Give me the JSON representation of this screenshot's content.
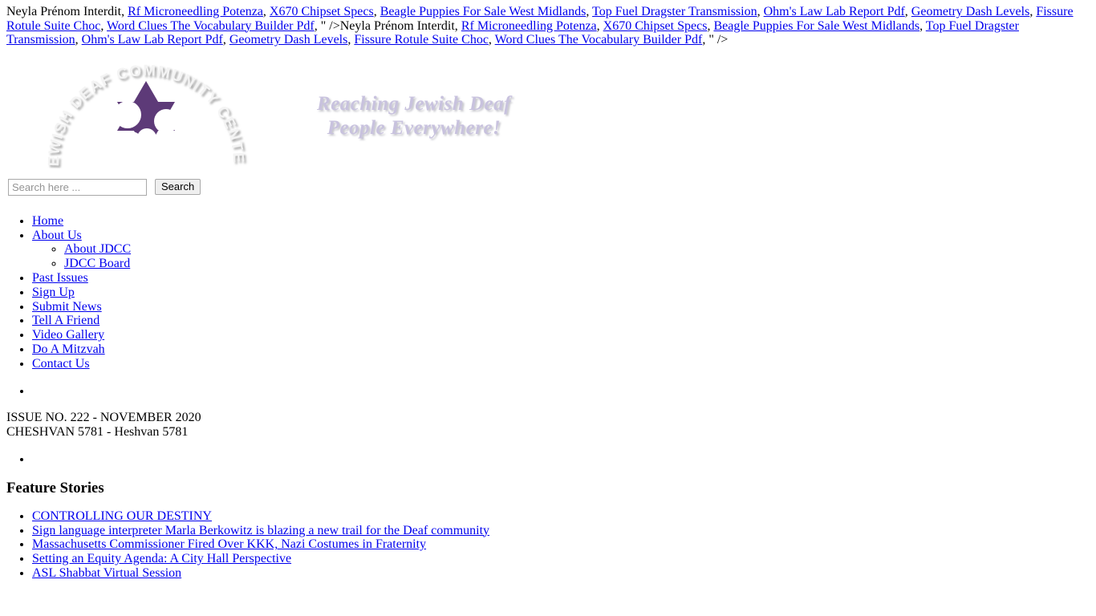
{
  "spam": {
    "segments": [
      {
        "type": "text",
        "text": "Neyla Prénom Interdit, "
      },
      {
        "type": "link",
        "text": "Rf Microneedling Potenza"
      },
      {
        "type": "text",
        "text": ", "
      },
      {
        "type": "link",
        "text": "X670 Chipset Specs"
      },
      {
        "type": "text",
        "text": ", "
      },
      {
        "type": "link",
        "text": "Beagle Puppies For Sale West Midlands"
      },
      {
        "type": "text",
        "text": ", "
      },
      {
        "type": "link",
        "text": "Top Fuel Dragster Transmission"
      },
      {
        "type": "text",
        "text": ", "
      },
      {
        "type": "link",
        "text": "Ohm's Law Lab Report Pdf"
      },
      {
        "type": "text",
        "text": ", "
      },
      {
        "type": "link",
        "text": "Geometry Dash Levels"
      },
      {
        "type": "text",
        "text": ", "
      },
      {
        "type": "link",
        "text": "Fissure Rotule Suite Choc"
      },
      {
        "type": "text",
        "text": ", "
      },
      {
        "type": "link",
        "text": "Word Clues The Vocabulary Builder Pdf"
      },
      {
        "type": "text",
        "text": ", \" />Neyla Prénom Interdit, "
      },
      {
        "type": "link",
        "text": "Rf Microneedling Potenza"
      },
      {
        "type": "text",
        "text": ", "
      },
      {
        "type": "link",
        "text": "X670 Chipset Specs"
      },
      {
        "type": "text",
        "text": ", "
      },
      {
        "type": "link",
        "text": "Beagle Puppies For Sale West Midlands"
      },
      {
        "type": "text",
        "text": ", "
      },
      {
        "type": "link",
        "text": "Top Fuel Dragster Transmission"
      },
      {
        "type": "text",
        "text": ", "
      },
      {
        "type": "link",
        "text": "Ohm's Law Lab Report Pdf"
      },
      {
        "type": "text",
        "text": ", "
      },
      {
        "type": "link",
        "text": "Geometry Dash Levels"
      },
      {
        "type": "text",
        "text": ", "
      },
      {
        "type": "link",
        "text": "Fissure Rotule Suite Choc"
      },
      {
        "type": "text",
        "text": ", "
      },
      {
        "type": "link",
        "text": "Word Clues The Vocabulary Builder Pdf"
      },
      {
        "type": "text",
        "text": ", \" />"
      }
    ]
  },
  "logo": {
    "arc_text": "JEWISH DEAF COMMUNITY CENTER",
    "alt": "Jewish Deaf Community Center logo",
    "purple": "#5d3a78",
    "arc_text_color": "#f2f2f2"
  },
  "tagline": {
    "line1": "Reaching Jewish Deaf",
    "line2": "People Everywhere!",
    "color": "#c8c2de"
  },
  "search": {
    "placeholder": "Search here ...",
    "value": "",
    "button_label": "Search"
  },
  "nav": {
    "items": [
      {
        "label": "Home",
        "children": []
      },
      {
        "label": "About Us",
        "children": [
          {
            "label": "About JDCC"
          },
          {
            "label": "JDCC Board"
          }
        ]
      },
      {
        "label": "Past Issues",
        "children": []
      },
      {
        "label": "Sign Up",
        "children": []
      },
      {
        "label": "Submit News",
        "children": []
      },
      {
        "label": "Tell A Friend",
        "children": []
      },
      {
        "label": "Video Gallery",
        "children": []
      },
      {
        "label": "Do A Mitzvah",
        "children": []
      },
      {
        "label": "Contact Us",
        "children": []
      }
    ]
  },
  "issue": {
    "line1": "ISSUE NO. 222 - NOVEMBER 2020",
    "line2": "CHESHVAN 5781 - Heshvan 5781"
  },
  "features": {
    "title": "Feature Stories",
    "stories": [
      {
        "label": "CONTROLLING OUR DESTINY"
      },
      {
        "label": "Sign language interpreter Marla Berkowitz is blazing a new trail for the Deaf community"
      },
      {
        "label": "Massachusetts Commissioner Fired Over KKK, Nazi Costumes in Fraternity"
      },
      {
        "label": "Setting an Equity Agenda: A City Hall Perspective"
      },
      {
        "label": "ASL Shabbat Virtual Session"
      }
    ]
  }
}
